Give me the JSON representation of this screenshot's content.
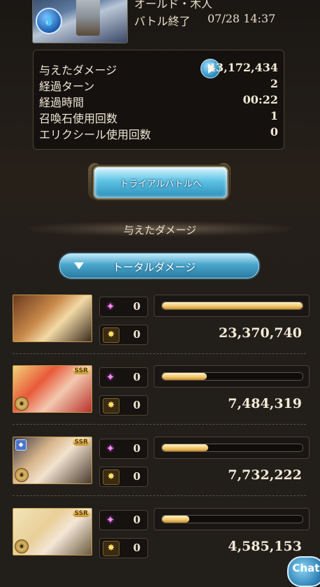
{
  "header": {
    "title": "オールド・木人",
    "status": "バトル終了",
    "datetime": "07/28 14:37",
    "element_icon": "water-element-icon"
  },
  "stats": {
    "rows": [
      {
        "label": "与えたダメージ",
        "value": "43,172,434"
      },
      {
        "label": "経過ターン",
        "value": "2"
      },
      {
        "label": "経過時間",
        "value": "00:22"
      },
      {
        "label": "召喚石使用回数",
        "value": "1"
      },
      {
        "label": "エリクシール使用回数",
        "value": "0"
      }
    ]
  },
  "trial_button": {
    "label": "トライアルバトルへ"
  },
  "section": {
    "title": "与えたダメージ"
  },
  "dropdown": {
    "label": "トータルダメージ"
  },
  "characters": [
    {
      "special_count": "0",
      "ability_count": "0",
      "damage": "23,370,740",
      "damage_ratio": 1.0,
      "ssr": ""
    },
    {
      "special_count": "0",
      "ability_count": "0",
      "damage": "7,484,319",
      "damage_ratio": 0.32,
      "ssr": "SSR"
    },
    {
      "special_count": "0",
      "ability_count": "0",
      "damage": "7,732,222",
      "damage_ratio": 0.33,
      "ssr": "SSR"
    },
    {
      "special_count": "0",
      "ability_count": "0",
      "damage": "4,585,153",
      "damage_ratio": 0.196,
      "ssr": "SSR"
    }
  ],
  "chat": {
    "label": "Chat"
  },
  "colors": {
    "accent": "#4aa6cc",
    "bar": "#f1c56b",
    "background": "#221e1a"
  }
}
